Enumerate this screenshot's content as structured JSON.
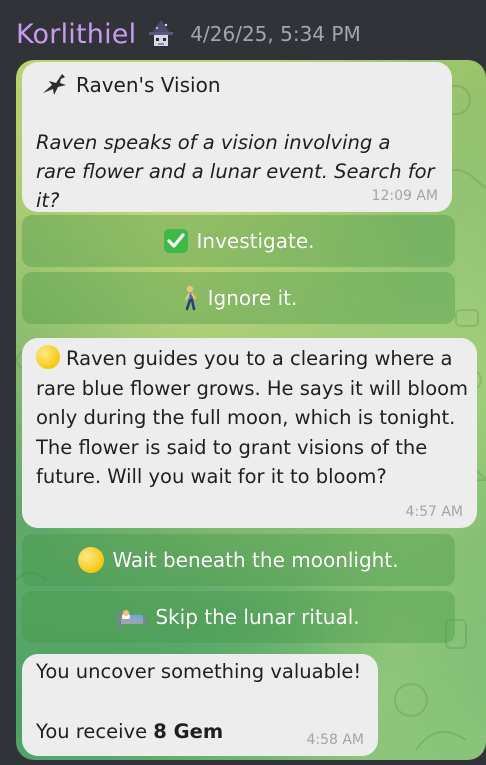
{
  "header": {
    "username": "Korlithiel",
    "badge_icon": "wizard-avatar-icon",
    "timestamp": "4/26/25, 5:34 PM"
  },
  "messages": [
    {
      "title_icon": "raven-icon",
      "title": "Raven's Vision",
      "body": "Raven speaks of a vision involving a rare flower and a lunar event. Search for it?",
      "time": "12:09 AM"
    },
    {
      "icon": "full-moon-icon",
      "body": "Raven guides you to a clearing where a rare blue flower grows. He says it will bloom only during the full moon, which is tonight. The flower is said to grant visions of the future. Will you wait for it to bloom?",
      "time": "4:57 AM"
    },
    {
      "line1": "You uncover something valuable!",
      "line2_prefix": "You receive",
      "line2_bold": "8 Gem",
      "time": "4:58 AM"
    }
  ],
  "buttons": [
    {
      "icon": "check-mark-icon",
      "label": "Investigate."
    },
    {
      "icon": "walking-person-icon",
      "label": "Ignore it."
    },
    {
      "icon": "full-moon-icon",
      "label": "Wait beneath the moonlight."
    },
    {
      "icon": "bed-icon",
      "label": "Skip the lunar ritual."
    }
  ],
  "colors": {
    "username": "#c99af1",
    "background": "#313338",
    "bubble": "#ededee",
    "button_overlay": "rgba(70,150,70,0.38)"
  }
}
